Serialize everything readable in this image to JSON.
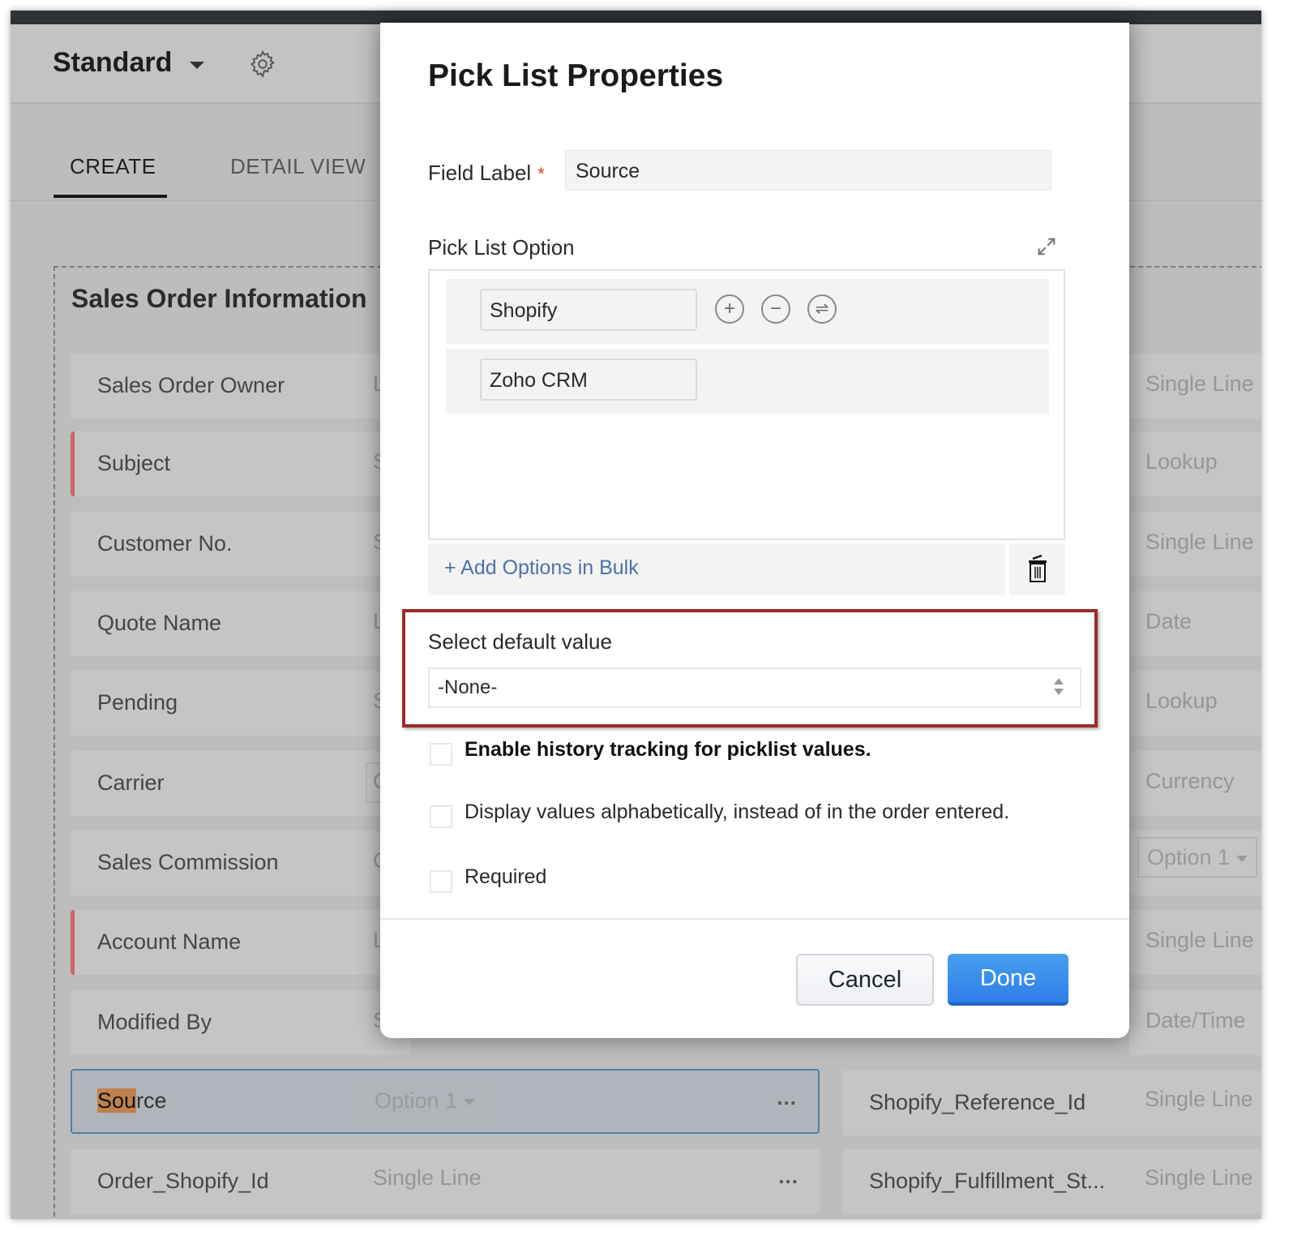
{
  "header": {
    "layout_name": "Standard",
    "layout_dropdown_icon": "caret-down-icon",
    "settings_icon": "gear-icon"
  },
  "tabs": [
    {
      "label": "CREATE",
      "active": true
    },
    {
      "label": "DETAIL VIEW",
      "active": false
    }
  ],
  "section": {
    "title": "Sales Order Information",
    "left_rows": [
      {
        "label": "Sales Order Owner",
        "required": false,
        "type_hint": "L"
      },
      {
        "label": "Subject",
        "required": true,
        "type_hint": "S"
      },
      {
        "label": "Customer No.",
        "required": false,
        "type_hint": "S"
      },
      {
        "label": "Quote Name",
        "required": false,
        "type_hint": "L"
      },
      {
        "label": "Pending",
        "required": false,
        "type_hint": "S"
      },
      {
        "label": "Carrier",
        "required": false,
        "type_hint": "O"
      },
      {
        "label": "Sales Commission",
        "required": false,
        "type_hint": "C"
      },
      {
        "label": "Account Name",
        "required": true,
        "type_hint": "L"
      },
      {
        "label": "Modified By",
        "required": false,
        "type_hint": "S"
      },
      {
        "label_highlight": "Sou",
        "label_rest": "rce",
        "type": "Option 1",
        "selected": true,
        "more": "..."
      },
      {
        "label": "Order_Shopify_Id",
        "type": "Single Line",
        "more": "..."
      }
    ],
    "right_types": [
      "Single Line",
      "Lookup",
      "Single Line",
      "Date",
      "Lookup",
      "Currency",
      "Option 1",
      "Single Line",
      "Date/Time"
    ],
    "right_rows": [
      {
        "label": "Shopify_Reference_Id",
        "type": "Single Line"
      },
      {
        "label": "Shopify_Fulfillment_St...",
        "type": "Single Line"
      }
    ]
  },
  "modal": {
    "title": "Pick List Properties",
    "field_label": "Field Label",
    "required_marker": "*",
    "field_label_value": "Source",
    "picklist_option_label": "Pick List Option",
    "expand_icon": "expand-icon",
    "options": [
      {
        "value": "Shopify",
        "actions": [
          "+",
          "−",
          "⇌"
        ]
      },
      {
        "value": "Zoho CRM"
      }
    ],
    "add_bulk_label": "+ Add Options in Bulk",
    "trash_icon": "trash-icon",
    "default_value_label": "Select default value",
    "default_value_selected": "-None-",
    "checkboxes": [
      {
        "label": "Enable history tracking for picklist values.",
        "checked": false,
        "bold": true
      },
      {
        "label": "Display values alphabetically, instead of in the order entered.",
        "checked": false
      },
      {
        "label": "Required",
        "checked": false
      }
    ],
    "cancel_label": "Cancel",
    "done_label": "Done"
  },
  "colors": {
    "accent_blue": "#2f7ee8",
    "highlight_border": "#9a2c28",
    "link_blue": "#4a72ad",
    "required_red": "#e23b2f"
  }
}
